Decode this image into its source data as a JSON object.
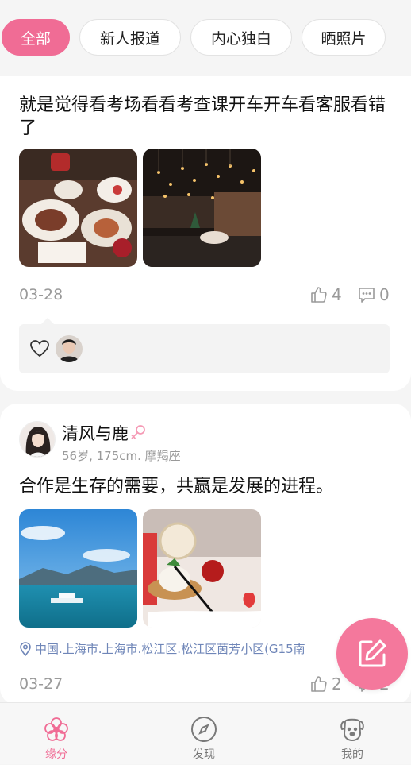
{
  "tabs": [
    {
      "label": "全部",
      "active": true
    },
    {
      "label": "新人报道",
      "active": false
    },
    {
      "label": "内心独白",
      "active": false
    },
    {
      "label": "晒照片",
      "active": false
    }
  ],
  "post1": {
    "text": "就是觉得看考场看看考查课开车开车看客服看错了",
    "date": "03-28",
    "likes": "4",
    "comments": "0"
  },
  "post2": {
    "user_name": "清风与鹿",
    "user_meta": "56岁, 175cm. 摩羯座",
    "text": "合作是生存的需要，共赢是发展的进程。",
    "location": "中国.上海市.上海市.松江区.松江区茵芳小区(G15南",
    "date": "03-27",
    "likes": "2",
    "comments": "2"
  },
  "nav": [
    {
      "label": "缘分",
      "icon": "flower-icon",
      "active": true
    },
    {
      "label": "发现",
      "icon": "compass-icon",
      "active": false
    },
    {
      "label": "我的",
      "icon": "dog-face-icon",
      "active": false
    }
  ],
  "colors": {
    "accent": "#f06c95",
    "fab": "#f4789c",
    "location": "#6f86b8"
  }
}
